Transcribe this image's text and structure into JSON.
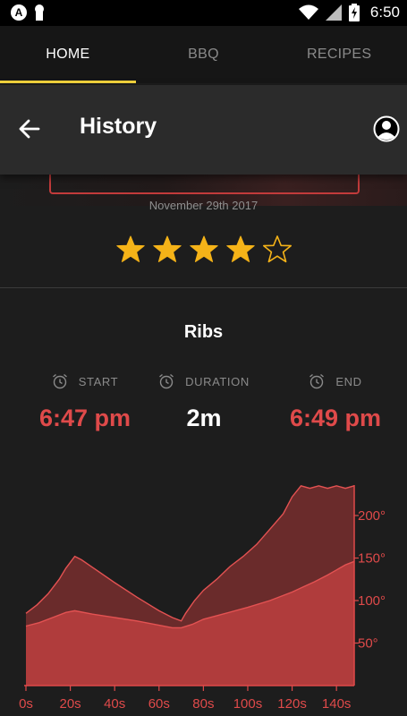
{
  "status_bar": {
    "time": "6:50",
    "badge": "A"
  },
  "tabs": [
    {
      "label": "HOME",
      "active": true
    },
    {
      "label": "BBQ",
      "active": false
    },
    {
      "label": "RECIPES",
      "active": false
    }
  ],
  "header": {
    "title": "History"
  },
  "cook": {
    "date": "November 29th 2017",
    "rating": 4,
    "max_rating": 5,
    "name": "Ribs",
    "start_label": "START",
    "start_value": "6:47 pm",
    "duration_label": "DURATION",
    "duration_value": "2m",
    "end_label": "END",
    "end_value": "6:49 pm"
  },
  "colors": {
    "accent_red": "#df4a4a",
    "tab_indicator": "#f2d33c",
    "star": "#f5b318"
  },
  "chart_data": {
    "type": "area",
    "title": "",
    "xlabel": "",
    "ylabel": "",
    "x_ticks": [
      "0s",
      "20s",
      "40s",
      "60s",
      "80s",
      "100s",
      "120s",
      "140s"
    ],
    "y_ticks": [
      "50°",
      "100°",
      "150°",
      "200°"
    ],
    "xlim": [
      0,
      148
    ],
    "ylim": [
      0,
      240
    ],
    "series": [
      {
        "values": [
          [
            0,
            85
          ],
          [
            5,
            95
          ],
          [
            10,
            108
          ],
          [
            15,
            125
          ],
          [
            18,
            138
          ],
          [
            20,
            145
          ],
          [
            22,
            152
          ],
          [
            25,
            148
          ],
          [
            30,
            139
          ],
          [
            40,
            121
          ],
          [
            50,
            104
          ],
          [
            60,
            88
          ],
          [
            66,
            80
          ],
          [
            70,
            76
          ],
          [
            72,
            85
          ],
          [
            76,
            100
          ],
          [
            80,
            112
          ],
          [
            86,
            125
          ],
          [
            92,
            140
          ],
          [
            98,
            152
          ],
          [
            104,
            166
          ],
          [
            110,
            184
          ],
          [
            116,
            202
          ],
          [
            120,
            222
          ],
          [
            124,
            235
          ],
          [
            128,
            232
          ],
          [
            132,
            235
          ],
          [
            136,
            232
          ],
          [
            140,
            235
          ],
          [
            144,
            232
          ],
          [
            148,
            235
          ]
        ]
      },
      {
        "values": [
          [
            0,
            70
          ],
          [
            6,
            74
          ],
          [
            12,
            80
          ],
          [
            18,
            86
          ],
          [
            22,
            88
          ],
          [
            30,
            84
          ],
          [
            40,
            80
          ],
          [
            50,
            76
          ],
          [
            60,
            71
          ],
          [
            66,
            68
          ],
          [
            70,
            68
          ],
          [
            75,
            72
          ],
          [
            80,
            78
          ],
          [
            90,
            85
          ],
          [
            100,
            92
          ],
          [
            110,
            100
          ],
          [
            120,
            110
          ],
          [
            125,
            116
          ],
          [
            130,
            122
          ],
          [
            136,
            130
          ],
          [
            140,
            136
          ],
          [
            144,
            142
          ],
          [
            148,
            146
          ]
        ]
      }
    ]
  }
}
